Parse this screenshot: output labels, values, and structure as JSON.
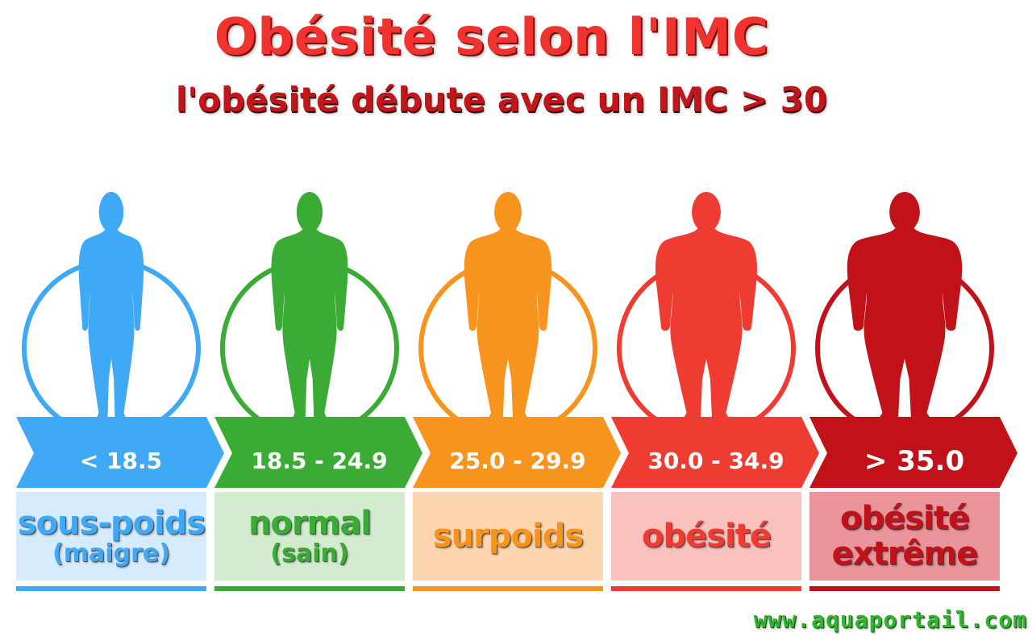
{
  "header": {
    "title": "Obésité selon l'IMC",
    "subtitle": "l'obésité débute avec un IMC > 30"
  },
  "categories": [
    {
      "range": "< 18.5",
      "label": "sous-poids",
      "sub": "(maigre)",
      "color": "#3fa9f5",
      "text_color": "#3fa9f5",
      "box_color": "#d6ebfb",
      "line_color": "#3fa9f5",
      "build": "slim"
    },
    {
      "range": "18.5 - 24.9",
      "label": "normal",
      "sub": "(sain)",
      "color": "#3aab34",
      "text_color": "#3aab34",
      "box_color": "#d3ecd0",
      "line_color": "#3aab34",
      "build": "normal"
    },
    {
      "range": "25.0 - 29.9",
      "label": "surpoids",
      "sub": "",
      "color": "#f7941d",
      "text_color": "#f7941d",
      "box_color": "#fdd5ae",
      "line_color": "#f7941d",
      "build": "over"
    },
    {
      "range": "30.0 - 34.9",
      "label": "obésité",
      "sub": "",
      "color": "#ef3c32",
      "text_color": "#ef3c32",
      "box_color": "#f9c2bf",
      "line_color": "#ef3c32",
      "build": "obese"
    },
    {
      "range": "> 35.0",
      "label": "obésité",
      "sub": "extrême",
      "color": "#c1121a",
      "text_color": "#c1121a",
      "box_color": "#e9959b",
      "line_color": "#c1121a",
      "build": "extreme"
    }
  ],
  "footer": {
    "website": "www.aquaportail.com"
  }
}
